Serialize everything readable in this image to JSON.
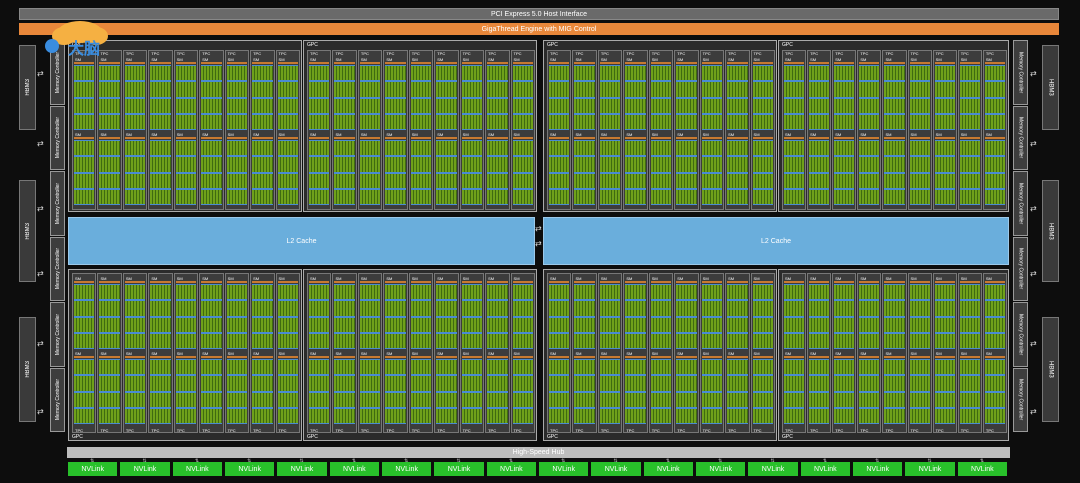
{
  "top": {
    "pcie": "PCI Express 5.0 Host Interface",
    "gigathread": "GigaThread Engine with MIG Control"
  },
  "hub": "High-Speed Hub",
  "hbm_label": "HBM3",
  "memory_controller_label": "Memory Controller",
  "l2_label": "L2 Cache",
  "gpc_label": "GPC",
  "tpc_label": "TPC",
  "sm_label": "SM",
  "nvlink_label": "NVLink",
  "nvlink_count": 18,
  "logo_text": "大脑",
  "colors": {
    "nvlink": "#28c02a",
    "l2": "#6aaedc",
    "gigathread": "#e8873a",
    "sm_core": "#6fa11a"
  }
}
